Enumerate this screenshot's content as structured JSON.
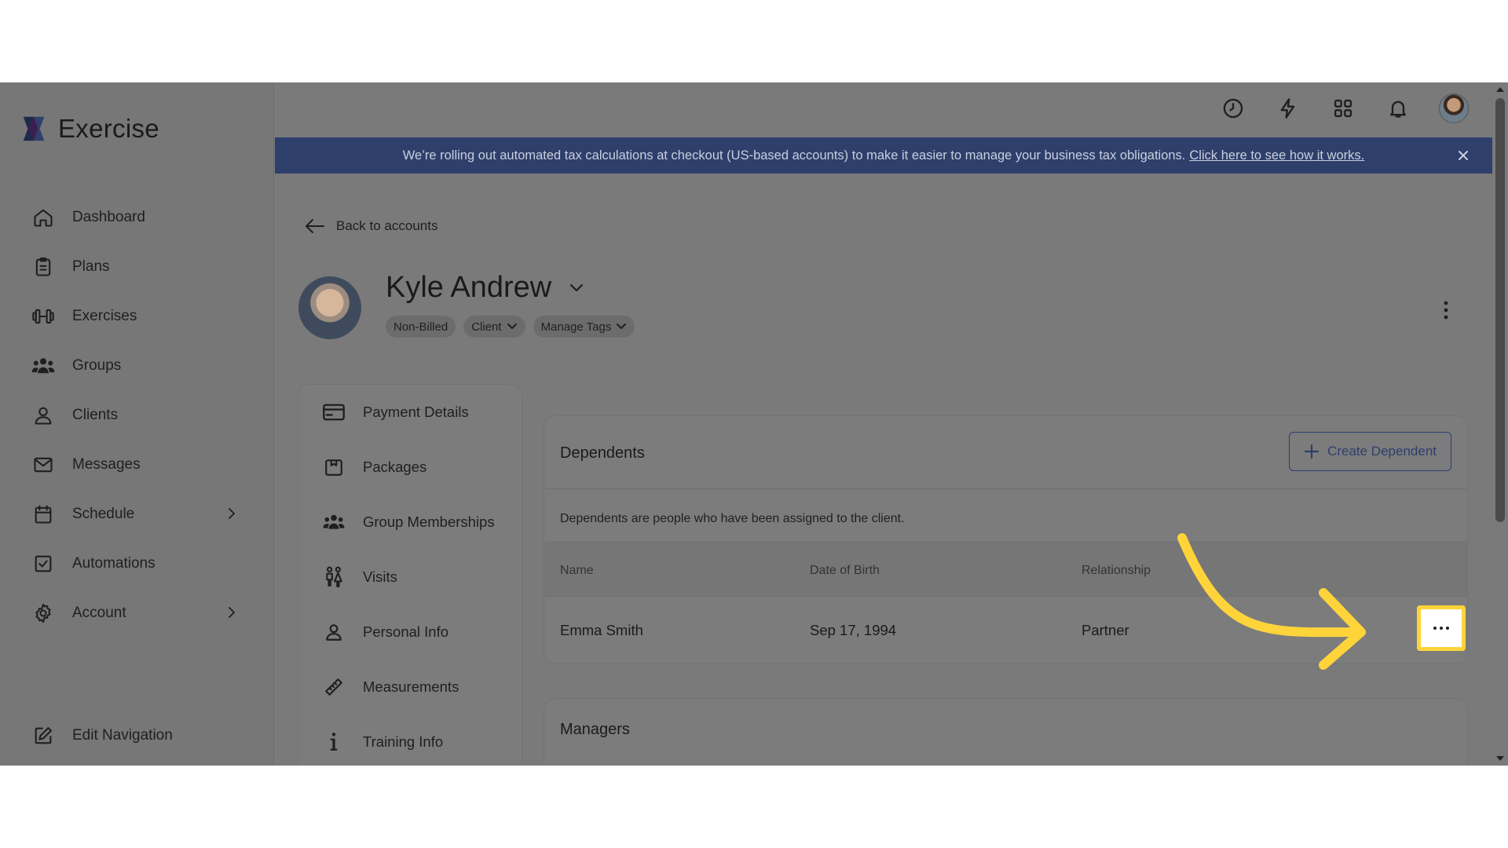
{
  "brand": {
    "name": "Exercise"
  },
  "sidebar": {
    "items": [
      {
        "label": "Dashboard",
        "icon": "home-icon"
      },
      {
        "label": "Plans",
        "icon": "clipboard-icon"
      },
      {
        "label": "Exercises",
        "icon": "dumbbell-icon"
      },
      {
        "label": "Groups",
        "icon": "users-icon"
      },
      {
        "label": "Clients",
        "icon": "user-icon"
      },
      {
        "label": "Messages",
        "icon": "mail-icon"
      },
      {
        "label": "Schedule",
        "icon": "calendar-icon",
        "has_submenu": true
      },
      {
        "label": "Automations",
        "icon": "checkbox-icon"
      },
      {
        "label": "Account",
        "icon": "gear-icon",
        "has_submenu": true
      }
    ],
    "edit_navigation": "Edit Navigation"
  },
  "topbar": {
    "icons": [
      "clock-icon",
      "lightning-icon",
      "apps-grid-icon",
      "bell-icon",
      "avatar"
    ]
  },
  "banner": {
    "text": "We’re rolling out automated tax calculations at checkout (US-based accounts) to make it easier to manage your business tax obligations.",
    "link": "Click here to see how it works."
  },
  "back_link": "Back to accounts",
  "client": {
    "name": "Kyle Andrew",
    "tags": [
      "Non-Billed",
      "Client",
      "Manage Tags"
    ]
  },
  "subnav": {
    "items": [
      {
        "label": "Payment Details",
        "icon": "credit-card-icon"
      },
      {
        "label": "Packages",
        "icon": "package-icon"
      },
      {
        "label": "Group Memberships",
        "icon": "group-icon"
      },
      {
        "label": "Visits",
        "icon": "visits-icon"
      },
      {
        "label": "Personal Info",
        "icon": "person-icon"
      },
      {
        "label": "Measurements",
        "icon": "ruler-icon"
      },
      {
        "label": "Training Info",
        "icon": "info-icon"
      }
    ]
  },
  "dependents": {
    "title": "Dependents",
    "create_button": "Create Dependent",
    "description": "Dependents are people who have been assigned to the client.",
    "columns": [
      "Name",
      "Date of Birth",
      "Relationship"
    ],
    "rows": [
      {
        "name": "Emma Smith",
        "dob": "Sep 17, 1994",
        "relationship": "Partner"
      }
    ]
  },
  "managers": {
    "title": "Managers"
  },
  "colors": {
    "highlight": "#ffd43b",
    "brand_blue": "#2d3f6d"
  }
}
